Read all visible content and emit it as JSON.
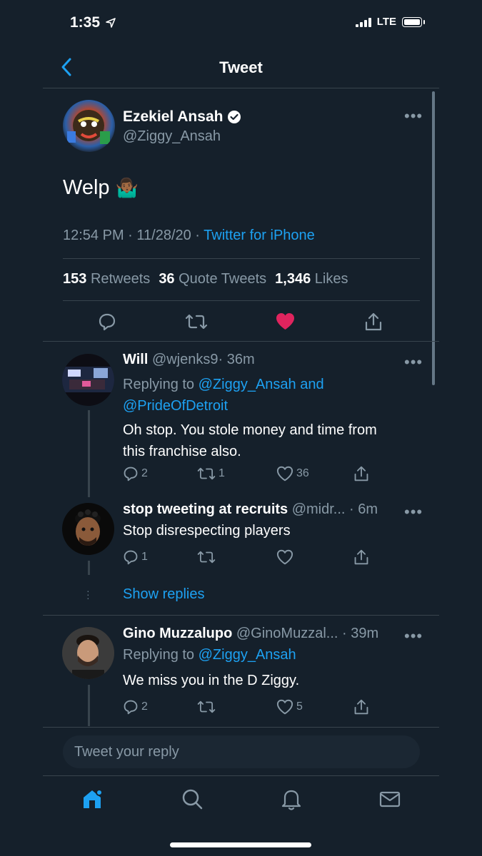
{
  "status_bar": {
    "time": "1:35",
    "network": "LTE"
  },
  "nav": {
    "title": "Tweet"
  },
  "main_tweet": {
    "author_name": "Ezekiel Ansah",
    "handle": "@Ziggy_Ansah",
    "text": "Welp",
    "emoji": "🤷🏾‍♂️",
    "time": "12:54 PM · 11/28/20 · ",
    "source": "Twitter for iPhone",
    "stats": {
      "retweets": "153",
      "retweets_label": "Retweets",
      "quotes": "36",
      "quotes_label": "Quote Tweets",
      "likes": "1,346",
      "likes_label": "Likes"
    },
    "liked": true
  },
  "replies": [
    {
      "name": "Will",
      "handle": "@wjenks9",
      "time": "· 36m",
      "replying_label": "Replying to ",
      "replying_1": "@Ziggy_Ansah",
      "replying_and": " and",
      "replying_2": "@PrideOfDetroit",
      "text_line1": "Oh stop. You stole money and time from",
      "text_line2": "this franchise also.",
      "counts": {
        "replies": "2",
        "retweets": "1",
        "likes": "36"
      }
    },
    {
      "name": "stop tweeting at recruits",
      "handle": "@midr...",
      "time": "· 6m",
      "text": "Stop disrespecting players",
      "counts": {
        "replies": "1",
        "retweets": "",
        "likes": ""
      }
    },
    {
      "name": "Gino Muzzalupo",
      "handle": "@GinoMuzzal...",
      "time": "· 39m",
      "replying_label": "Replying to ",
      "replying_1": "@Ziggy_Ansah",
      "text": "We miss you in the D Ziggy.",
      "counts": {
        "replies": "2",
        "retweets": "",
        "likes": "5"
      }
    }
  ],
  "show_replies": "Show replies",
  "reply_input": {
    "placeholder": "Tweet your reply"
  },
  "colors": {
    "background": "#15202b",
    "accent": "#1da1f2",
    "muted": "#8899a6",
    "like": "#e0245e",
    "divider": "#38444d"
  }
}
